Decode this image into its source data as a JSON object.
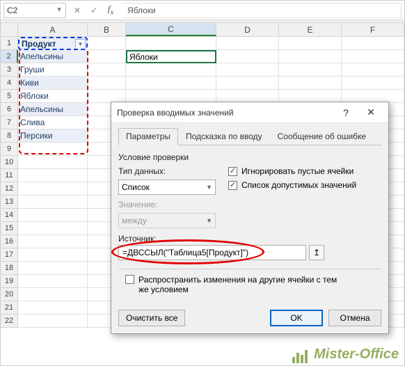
{
  "name_box": "C2",
  "formula_bar_value": "Яблоки",
  "columns": [
    "A",
    "B",
    "C",
    "D",
    "E",
    "F"
  ],
  "rows": 22,
  "selected_cell": {
    "col": "C",
    "row": 2
  },
  "table_header": "Продукт",
  "table_values": [
    "Апельсины",
    "Груши",
    "Киви",
    "Яблоки",
    "Апельсины",
    "Слива",
    "Персики"
  ],
  "cell_C2": "Яблоки",
  "dialog": {
    "title": "Проверка вводимых значений",
    "tabs": [
      "Параметры",
      "Подсказка по вводу",
      "Сообщение об ошибке"
    ],
    "active_tab": 0,
    "section": "Условие проверки",
    "type_label": "Тип данных:",
    "type_value": "Список",
    "value_label": "Значение:",
    "value_value": "между",
    "ignore_blank": "Игнорировать пустые ячейки",
    "in_cell_dropdown": "Список допустимых значений",
    "source_label": "Источник:",
    "source_value": "=ДВССЫЛ(\"Таблица5[Продукт]\")",
    "propagate": "Распространить изменения на другие ячейки с тем же условием",
    "clear_all": "Очистить все",
    "ok": "OK",
    "cancel": "Отмена"
  },
  "watermark": "Mister-Office"
}
